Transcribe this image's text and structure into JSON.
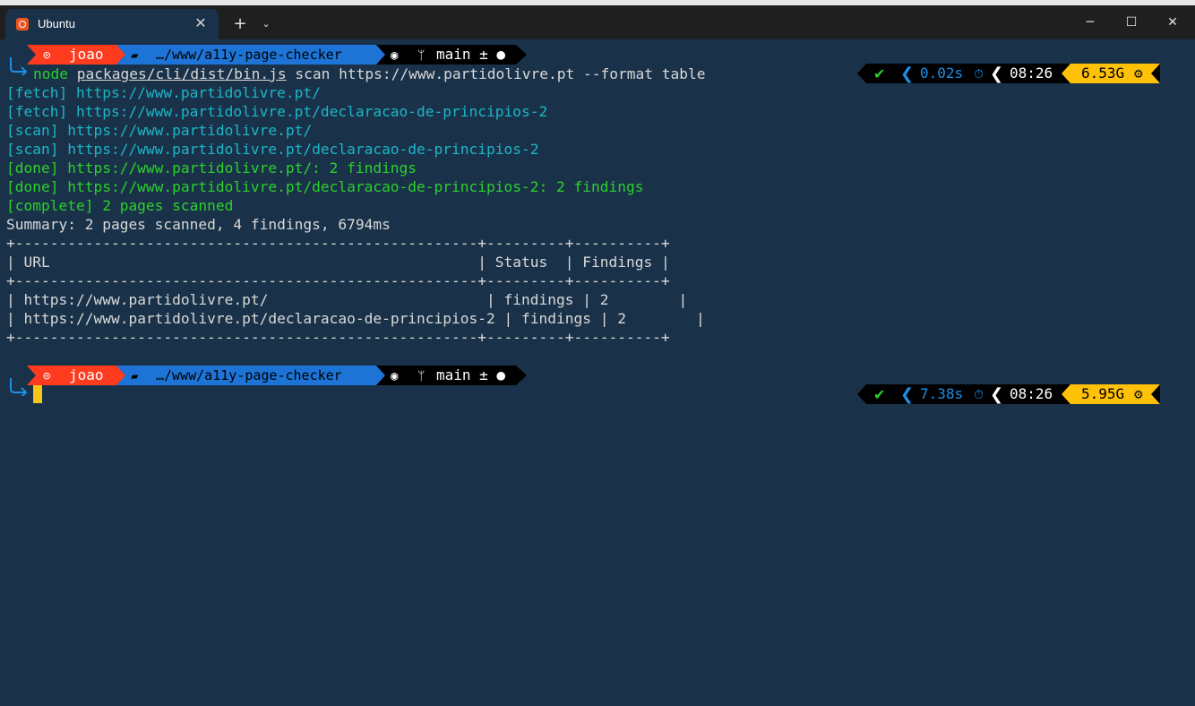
{
  "window": {
    "tab_title": "Ubuntu",
    "close_glyph": "✕",
    "new_tab_glyph": "+",
    "dropdown_glyph": "⌄",
    "minimize_glyph": "─",
    "maximize_glyph": "☐",
    "close_window_glyph": "✕"
  },
  "colors": {
    "background": "#1a3249",
    "user_segment": "#ff3b1f",
    "path_segment": "#1d74d6",
    "git_segment": "#000000",
    "status_ok": "#2bd02b",
    "duration": "#1d8fe8",
    "clock_segment": "#000000",
    "memory_segment": "#ffc107"
  },
  "prompt1": {
    "user": "joao",
    "path": "…/www/a11y-page-checker",
    "branch": "main ± ●",
    "duration": "0.02s",
    "time": "08:26",
    "memory": "6.53G"
  },
  "command": {
    "prefix": "node",
    "path": "packages/cli/dist/bin.js",
    "args": "scan https://www.partidolivre.pt --format table"
  },
  "output": {
    "fetch1": "[fetch] https://www.partidolivre.pt/",
    "fetch2": "[fetch] https://www.partidolivre.pt/declaracao-de-principios-2",
    "scan1": "[scan] https://www.partidolivre.pt/",
    "scan2": "[scan] https://www.partidolivre.pt/declaracao-de-principios-2",
    "done1": "[done] https://www.partidolivre.pt/: 2 findings",
    "done2": "[done] https://www.partidolivre.pt/declaracao-de-principios-2: 2 findings",
    "complete": "[complete] 2 pages scanned",
    "summary": "Summary: 2 pages scanned, 4 findings, 6794ms"
  },
  "table": {
    "border": "+-----------------------------------------------------+----------+----------+",
    "header": "| URL                                                 | Status   | Findings |",
    "row1": "| https://www.partidolivre.pt/                        | findings | 2        |",
    "row2": "| https://www.partidolivre.pt/declaracao-de-principios-2 | findings | 2        |",
    "columns": [
      "URL",
      "Status",
      "Findings"
    ],
    "rows": [
      [
        "https://www.partidolivre.pt/",
        "findings",
        "2"
      ],
      [
        "https://www.partidolivre.pt/declaracao-de-principios-2",
        "findings",
        "2"
      ]
    ]
  },
  "prompt2": {
    "user": "joao",
    "path": "…/www/a11y-page-checker",
    "branch": "main ± ●",
    "duration": "7.38s",
    "time": "08:26",
    "memory": "5.95G"
  }
}
